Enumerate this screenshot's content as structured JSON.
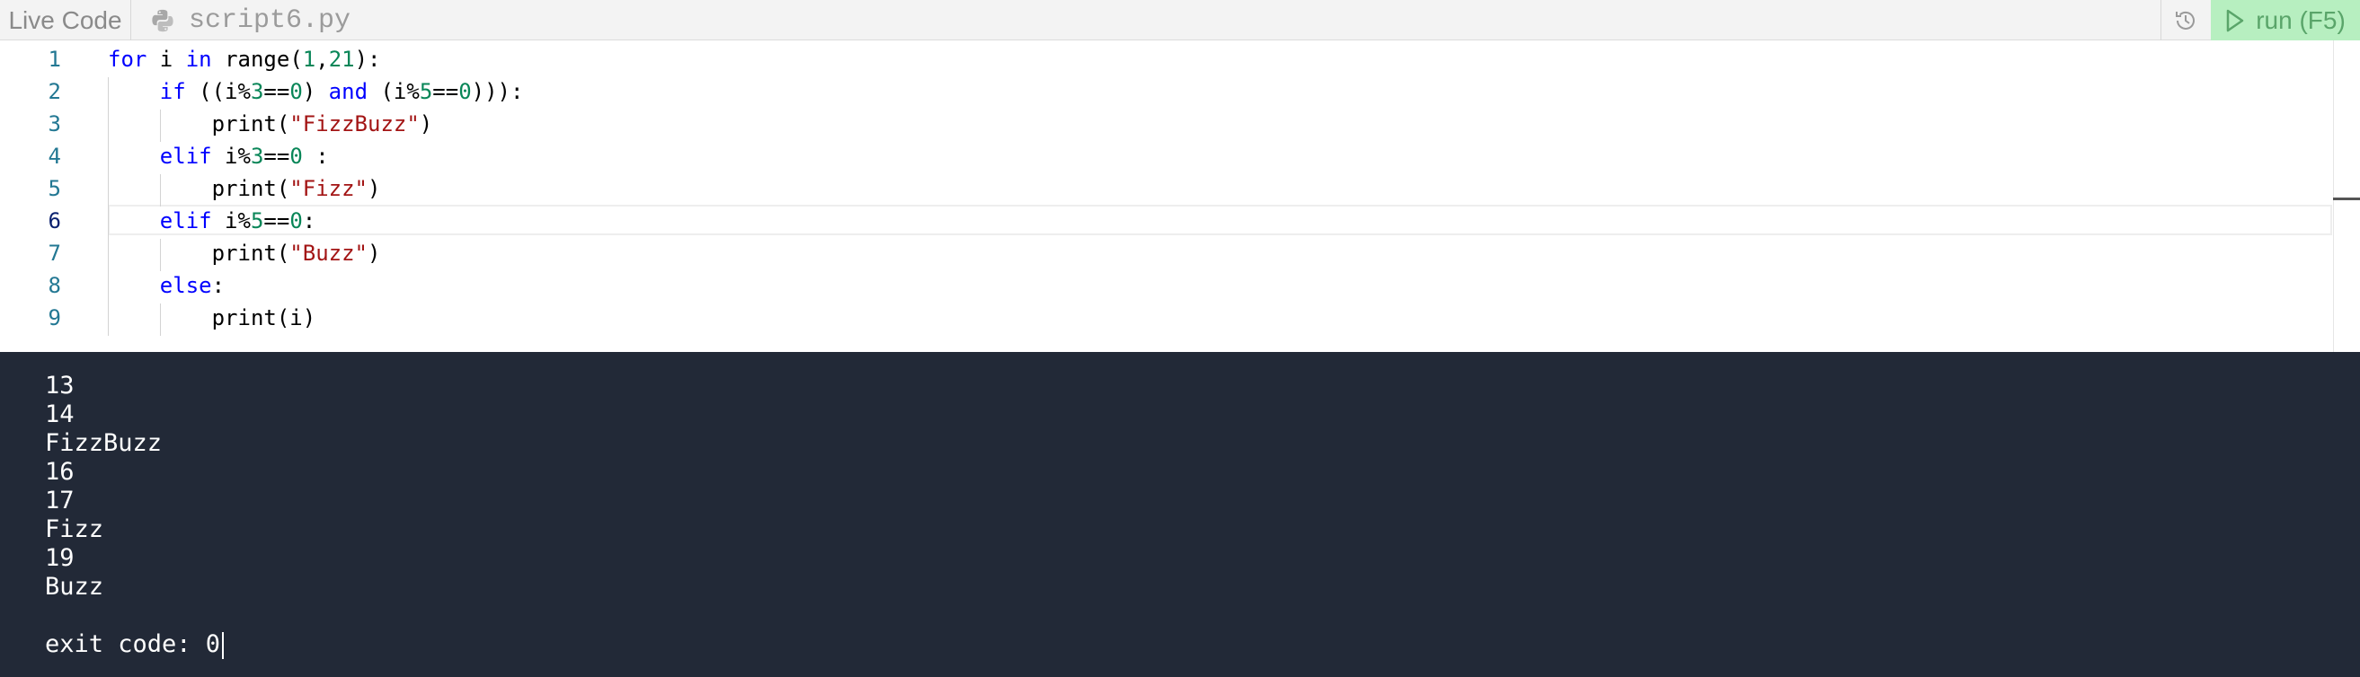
{
  "topbar": {
    "app_label": "Live Code",
    "file_name": "script6.py",
    "run_label": "run (F5)",
    "icons": {
      "file": "python-icon",
      "history": "history-icon",
      "run": "play-icon"
    }
  },
  "editor": {
    "active_line": 6,
    "lines": [
      {
        "n": "1",
        "indent": "",
        "tokens": [
          [
            "kw",
            "for"
          ],
          [
            "t",
            " i "
          ],
          [
            "kw",
            "in"
          ],
          [
            "t",
            " range("
          ],
          [
            "num",
            "1"
          ],
          [
            "t",
            ","
          ],
          [
            "num",
            "21"
          ],
          [
            "t",
            "):"
          ]
        ]
      },
      {
        "n": "2",
        "indent": "    ",
        "tokens": [
          [
            "kw",
            "if"
          ],
          [
            "t",
            " ((i%"
          ],
          [
            "num",
            "3"
          ],
          [
            "t",
            "=="
          ],
          [
            "num",
            "0"
          ],
          [
            "t",
            ") "
          ],
          [
            "kw",
            "and"
          ],
          [
            "t",
            " (i%"
          ],
          [
            "num",
            "5"
          ],
          [
            "t",
            "=="
          ],
          [
            "num",
            "0"
          ],
          [
            "t",
            "))):"
          ]
        ]
      },
      {
        "n": "3",
        "indent": "        ",
        "tokens": [
          [
            "t",
            "print("
          ],
          [
            "str",
            "\"FizzBuzz\""
          ],
          [
            "t",
            ")"
          ]
        ]
      },
      {
        "n": "4",
        "indent": "    ",
        "tokens": [
          [
            "kw",
            "elif"
          ],
          [
            "t",
            " i%"
          ],
          [
            "num",
            "3"
          ],
          [
            "t",
            "=="
          ],
          [
            "num",
            "0"
          ],
          [
            "t",
            " :"
          ]
        ]
      },
      {
        "n": "5",
        "indent": "        ",
        "tokens": [
          [
            "t",
            "print("
          ],
          [
            "str",
            "\"Fizz\""
          ],
          [
            "t",
            ")"
          ]
        ]
      },
      {
        "n": "6",
        "indent": "    ",
        "tokens": [
          [
            "kw",
            "elif"
          ],
          [
            "t",
            " i%"
          ],
          [
            "num",
            "5"
          ],
          [
            "t",
            "=="
          ],
          [
            "num",
            "0"
          ],
          [
            "t",
            ":"
          ]
        ]
      },
      {
        "n": "7",
        "indent": "        ",
        "tokens": [
          [
            "t",
            "print("
          ],
          [
            "str",
            "\"Buzz\""
          ],
          [
            "t",
            ")"
          ]
        ]
      },
      {
        "n": "8",
        "indent": "    ",
        "tokens": [
          [
            "kw",
            "else"
          ],
          [
            "t",
            ":"
          ]
        ]
      },
      {
        "n": "9",
        "indent": "        ",
        "tokens": [
          [
            "t",
            "print(i)"
          ]
        ]
      }
    ]
  },
  "console": {
    "output": [
      "13",
      "14",
      "FizzBuzz",
      "16",
      "17",
      "Fizz",
      "19",
      "Buzz"
    ],
    "exit_line": "exit code: 0"
  }
}
